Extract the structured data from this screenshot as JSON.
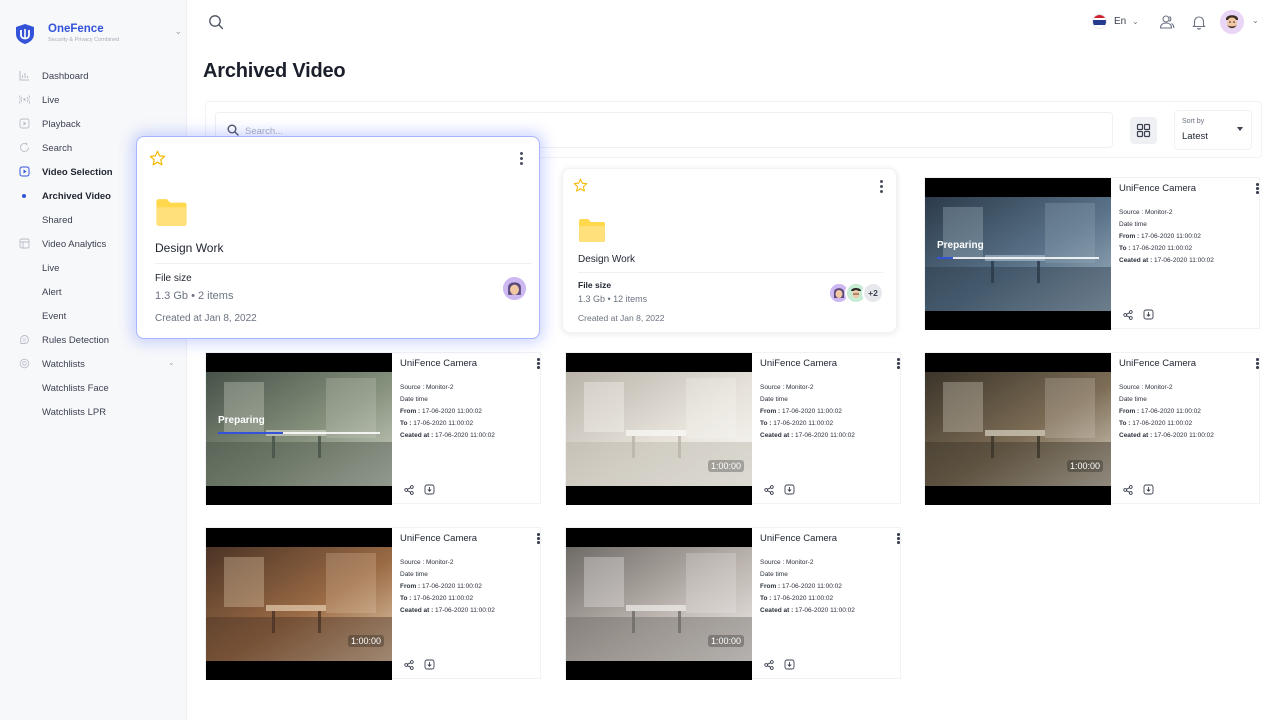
{
  "brand": {
    "name": "OneFence",
    "tagline": "Security & Privacy Combined"
  },
  "sidebar": {
    "items": [
      {
        "label": "Dashboard",
        "icon": "chart-icon",
        "bold": false
      },
      {
        "label": "Live",
        "icon": "live-signal-icon",
        "bold": false
      },
      {
        "label": "Playback",
        "icon": "playback-icon",
        "bold": false
      },
      {
        "label": "Search",
        "icon": "search-history-icon",
        "bold": false
      },
      {
        "label": "Video Selection",
        "icon": "video-selection-icon",
        "bold": true
      },
      {
        "label": "Archived Video",
        "icon": "active-dot",
        "bold": true
      },
      {
        "label": "Shared",
        "icon": "",
        "bold": false
      },
      {
        "label": "Video Analytics",
        "icon": "analytics-icon",
        "bold": false
      },
      {
        "label": "Live",
        "icon": "",
        "bold": false
      },
      {
        "label": "Alert",
        "icon": "",
        "bold": false
      },
      {
        "label": "Event",
        "icon": "",
        "bold": false
      },
      {
        "label": "Rules Detection",
        "icon": "rules-icon",
        "bold": false
      },
      {
        "label": "Watchlists",
        "icon": "watchlist-icon",
        "bold": false
      },
      {
        "label": "Watchlists Face",
        "icon": "",
        "bold": false
      },
      {
        "label": "Watchlists LPR",
        "icon": "",
        "bold": false
      }
    ]
  },
  "header": {
    "language": "En"
  },
  "page": {
    "title": "Archived Video"
  },
  "toolbar": {
    "search_placeholder": "Search...",
    "sort_label": "Sort by",
    "sort_value": "Latest"
  },
  "folders": [
    {
      "name": "Design Work",
      "size_label": "File size",
      "size_value": "1.3 Gb • 2 items",
      "created": "Created at Jan 8, 2022"
    },
    {
      "name": "Design Work",
      "size_label": "File size",
      "size_value": "1.3 Gb • 12 items",
      "created": "Created at Jan 8, 2022",
      "more": "+2"
    }
  ],
  "videos": [
    {
      "title": "UniFence Camera",
      "source": "Source : Monitor-2",
      "datetime": "Date time",
      "from_label": "From :",
      "from": " 17-06-2020 11:00:02",
      "to_label": "To :",
      "to": " 17-06-2020 11:00:02",
      "created_label": "Ceated at :",
      "created": " 17-06-2020 11:00:02",
      "status": "Preparing",
      "progress": 0.1
    },
    {
      "title": "UniFence Camera",
      "source": "Source : Monitor-2",
      "datetime": "Date time",
      "from_label": "From :",
      "from": " 17-06-2020 11:00:02",
      "to_label": "To :",
      "to": " 17-06-2020 11:00:02",
      "created_label": "Ceated at :",
      "created": " 17-06-2020 11:00:02",
      "status": "Preparing",
      "progress": 0.4
    },
    {
      "title": "UniFence Camera",
      "source": "Source : Monitor-2",
      "datetime": "Date time",
      "from_label": "From :",
      "from": " 17-06-2020 11:00:02",
      "to_label": "To :",
      "to": " 17-06-2020 11:00:02",
      "created_label": "Ceated at :",
      "created": " 17-06-2020 11:00:02",
      "duration": "1:00:00"
    },
    {
      "title": "UniFence Camera",
      "source": "Source : Monitor-2",
      "datetime": "Date time",
      "from_label": "From :",
      "from": " 17-06-2020 11:00:02",
      "to_label": "To :",
      "to": " 17-06-2020 11:00:02",
      "created_label": "Ceated at :",
      "created": " 17-06-2020 11:00:02",
      "duration": "1:00:00"
    },
    {
      "title": "UniFence Camera",
      "source": "Source : Monitor-2",
      "datetime": "Date time",
      "from_label": "From :",
      "from": " 17-06-2020 11:00:02",
      "to_label": "To :",
      "to": " 17-06-2020 11:00:02",
      "created_label": "Ceated at :",
      "created": " 17-06-2020 11:00:02",
      "duration": "1:00:00"
    },
    {
      "title": "UniFence Camera",
      "source": "Source : Monitor-2",
      "datetime": "Date time",
      "from_label": "From :",
      "from": " 17-06-2020 11:00:02",
      "to_label": "To :",
      "to": " 17-06-2020 11:00:02",
      "created_label": "Ceated at :",
      "created": " 17-06-2020 11:00:02",
      "duration": "1:00:00"
    },
    {
      "title": "UniFence Camera",
      "source": "Source : Monitor-2",
      "datetime": "Date time",
      "from_label": "From :",
      "from": " 17-06-2020 11:00:02",
      "to_label": "To :",
      "to": " 17-06-2020 11:00:02",
      "created_label": "Ceated at :",
      "created": " 17-06-2020 11:00:02",
      "duration": "1:00:00"
    }
  ],
  "colors": {
    "brand": "#3453d9",
    "folder": "#ffd84d",
    "star": "#f5b800",
    "hover_border": "#a9b6ff"
  }
}
